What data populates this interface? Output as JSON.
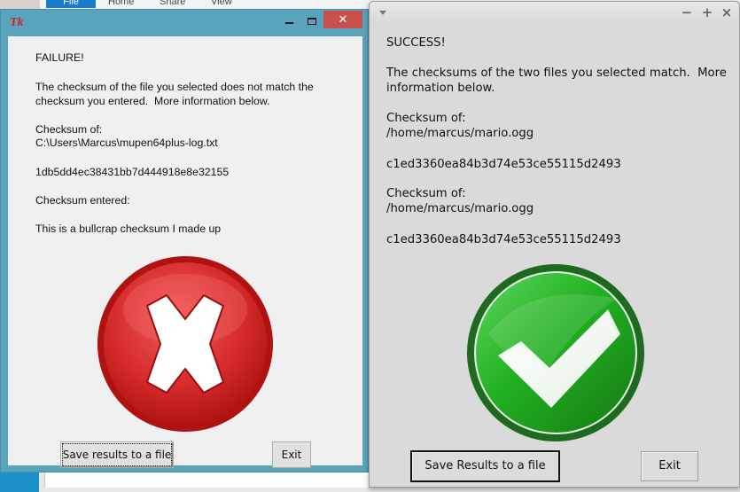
{
  "background": {
    "ribbon_tabs": [
      "File",
      "Home",
      "Share",
      "View"
    ]
  },
  "failure_window": {
    "title_icon": "Tk",
    "controls": {
      "minimize": "minimize",
      "maximize": "maximize",
      "close": "✕"
    },
    "status": "FAILURE!",
    "message_line1": "The checksum of the file you selected does not match the",
    "message_line2": "checksum you entered.  More information below.",
    "checksum_of_label": "Checksum of:",
    "file_path": "C:\\Users\\Marcus\\mupen64plus-log.txt",
    "file_checksum": "1db5dd4ec38431bb7d444918e8e32155",
    "entered_label": "Checksum entered:",
    "entered_value": "This is a bullcrap checksum I made up",
    "icon": "error-x-icon",
    "save_button": "Save results to a file",
    "exit_button": "Exit",
    "colors": {
      "frame": "#5aa3bd",
      "close": "#c9504a",
      "icon_red": "#d42a2a"
    }
  },
  "success_window": {
    "controls": {
      "minimize": "−",
      "maximize": "+",
      "close": "×"
    },
    "status": "SUCCESS!",
    "message_line1": "The checksums of the two files you selected match.  More",
    "message_line2": "information below.",
    "first": {
      "label": "Checksum of:",
      "path": "/home/marcus/mario.ogg",
      "checksum": "c1ed3360ea84b3d74e53ce55115d2493"
    },
    "second": {
      "label": "Checksum of:",
      "path": "/home/marcus/mario.ogg",
      "checksum": "c1ed3360ea84b3d74e53ce55115d2493"
    },
    "icon": "success-check-icon",
    "save_button": "Save Results to a file",
    "exit_button": "Exit",
    "colors": {
      "icon_green": "#1fa31f",
      "ring": "#1e6a1e"
    }
  }
}
